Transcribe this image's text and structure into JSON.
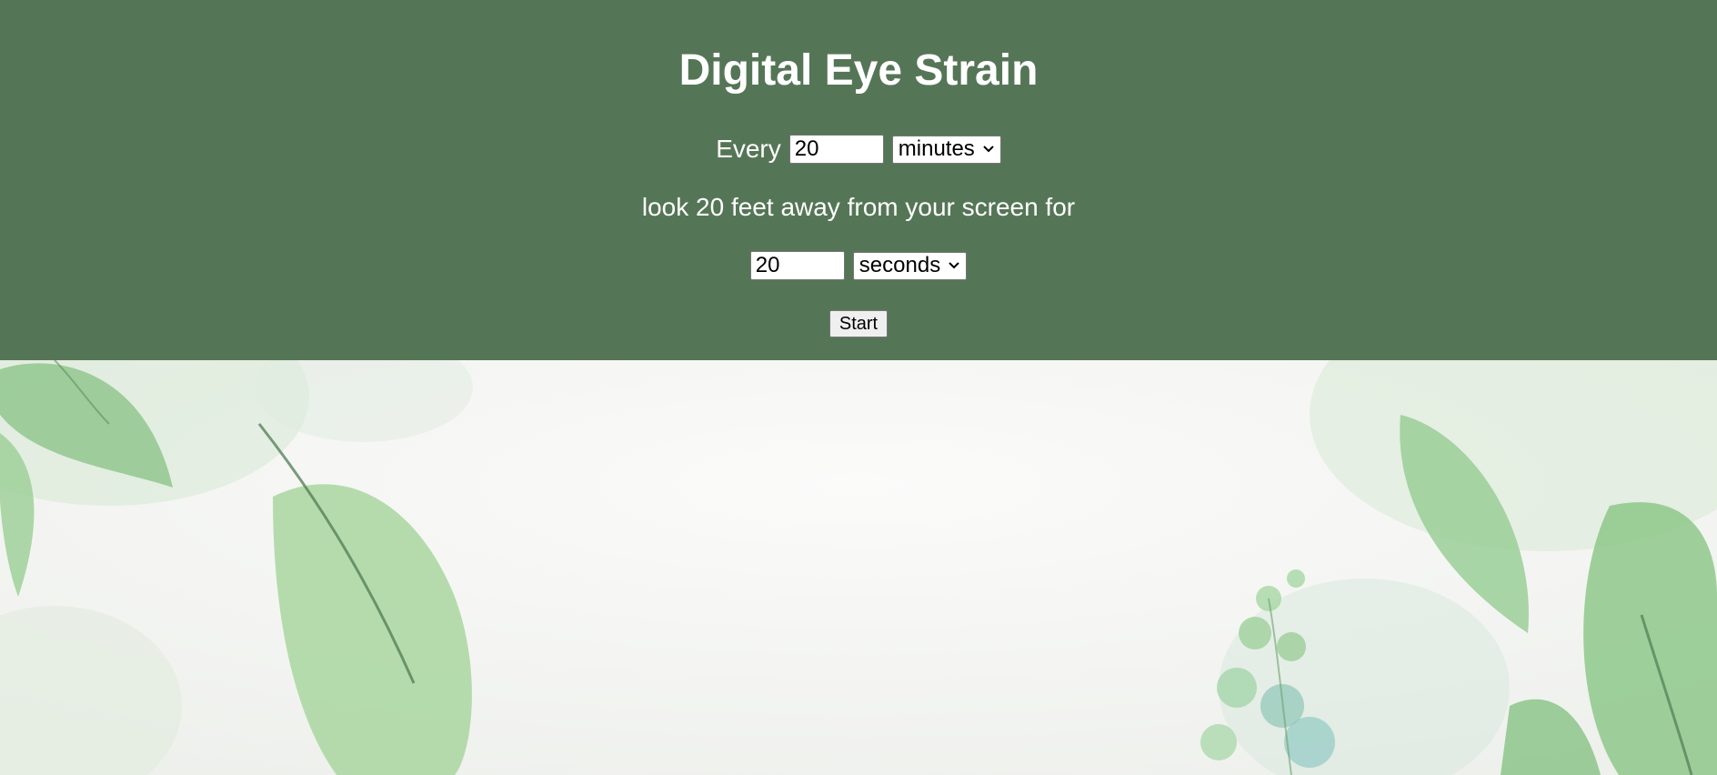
{
  "header": {
    "title": "Digital Eye Strain",
    "every_label": "Every",
    "interval": {
      "value": "20",
      "unit": "minutes"
    },
    "instruction": "look 20 feet away from your screen for",
    "duration": {
      "value": "20",
      "unit": "seconds"
    },
    "start_label": "Start"
  },
  "colors": {
    "header_bg": "#557656",
    "text": "#ffffff"
  },
  "icons": {
    "dropdown": "chevron-down-icon"
  },
  "background": {
    "style": "watercolor green leaves on white paper"
  }
}
